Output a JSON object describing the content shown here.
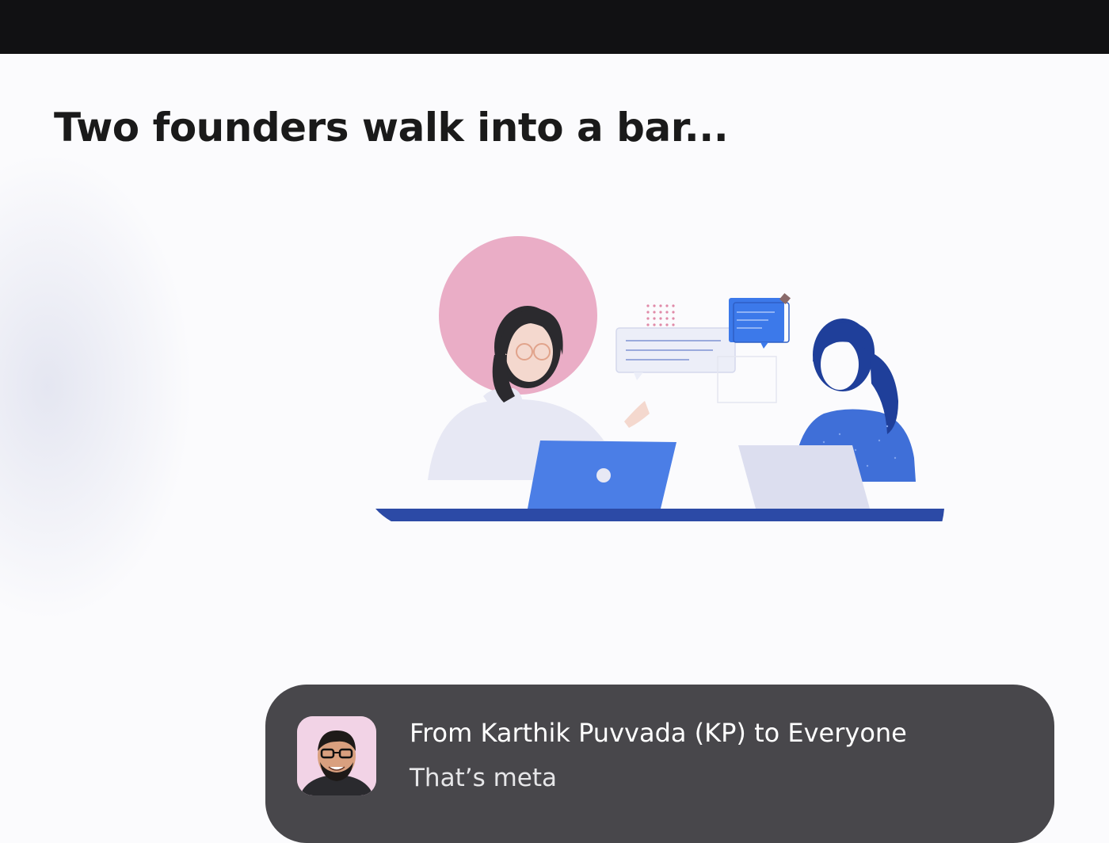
{
  "slide": {
    "title": "Two founders walk into a bar..."
  },
  "illustration": {
    "icon": "two-people-chatting-with-laptops",
    "colors": {
      "pink_circle": "#eaadc6",
      "table_blue": "#2c4aa6",
      "laptop_blue": "#4b7ee6",
      "chat_blue": "#3c79ea"
    }
  },
  "chat_notification": {
    "from_text": "From Karthik Puvvada (KP) to Everyone",
    "message": "That’s meta",
    "avatar_icon": "user-avatar"
  },
  "colors": {
    "top_bar": "#111113",
    "background": "#fbfbfd",
    "notification_bg": "#48474b",
    "title_text": "#1a1a1a"
  }
}
